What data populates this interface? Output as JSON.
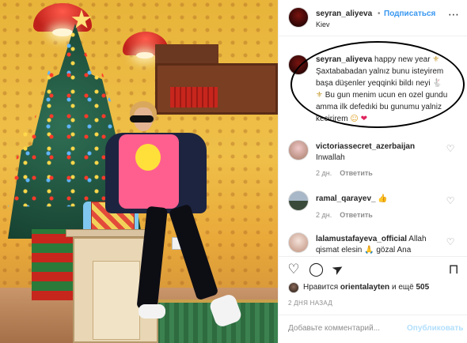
{
  "post": {
    "header": {
      "username": "seyran_aliyeva",
      "separator": "•",
      "follow_label": "Подписаться",
      "location": "Kiev"
    },
    "caption": {
      "username": "seyran_aliyeva",
      "text_1": "happy new year",
      "text_2": "Şaxtababadan yalnız bunu isteyirem başa düşenler yeqqinki bildı neyi",
      "text_3": "Bu gun menim ucun en ozel gundu amma ilk defedıki bu gunumu yalniz kecirirem",
      "emoji_1": "⚜",
      "emoji_2": "🐇",
      "emoji_3": "⚜",
      "emoji_4": "☺",
      "emoji_5": "❤"
    },
    "comments": [
      {
        "username": "victoriassecret_azerbaijan",
        "text": "Inwallah",
        "time": "2 дн.",
        "reply": "Ответить"
      },
      {
        "username": "ramal_qarayev_",
        "text": "",
        "emoji": "👍",
        "time": "2 дн.",
        "reply": "Ответить"
      },
      {
        "username": "lalamustafayeva_official",
        "text": "Allah qismat elesin",
        "emoji": "🙏",
        "text_after": "gözal Ana"
      }
    ],
    "likes": {
      "prefix": "Нравится",
      "user": "orientalayten",
      "middle": "и ещё",
      "count": "505"
    },
    "date": "2 ДНЯ НАЗАД",
    "comment_box": {
      "placeholder": "Добавьте комментарий...",
      "publish_label": "Опубликовать"
    },
    "icons": {
      "more": "⋯",
      "heart": "♡",
      "comment": "◯",
      "share": "➤",
      "bookmark": "⊓"
    }
  }
}
